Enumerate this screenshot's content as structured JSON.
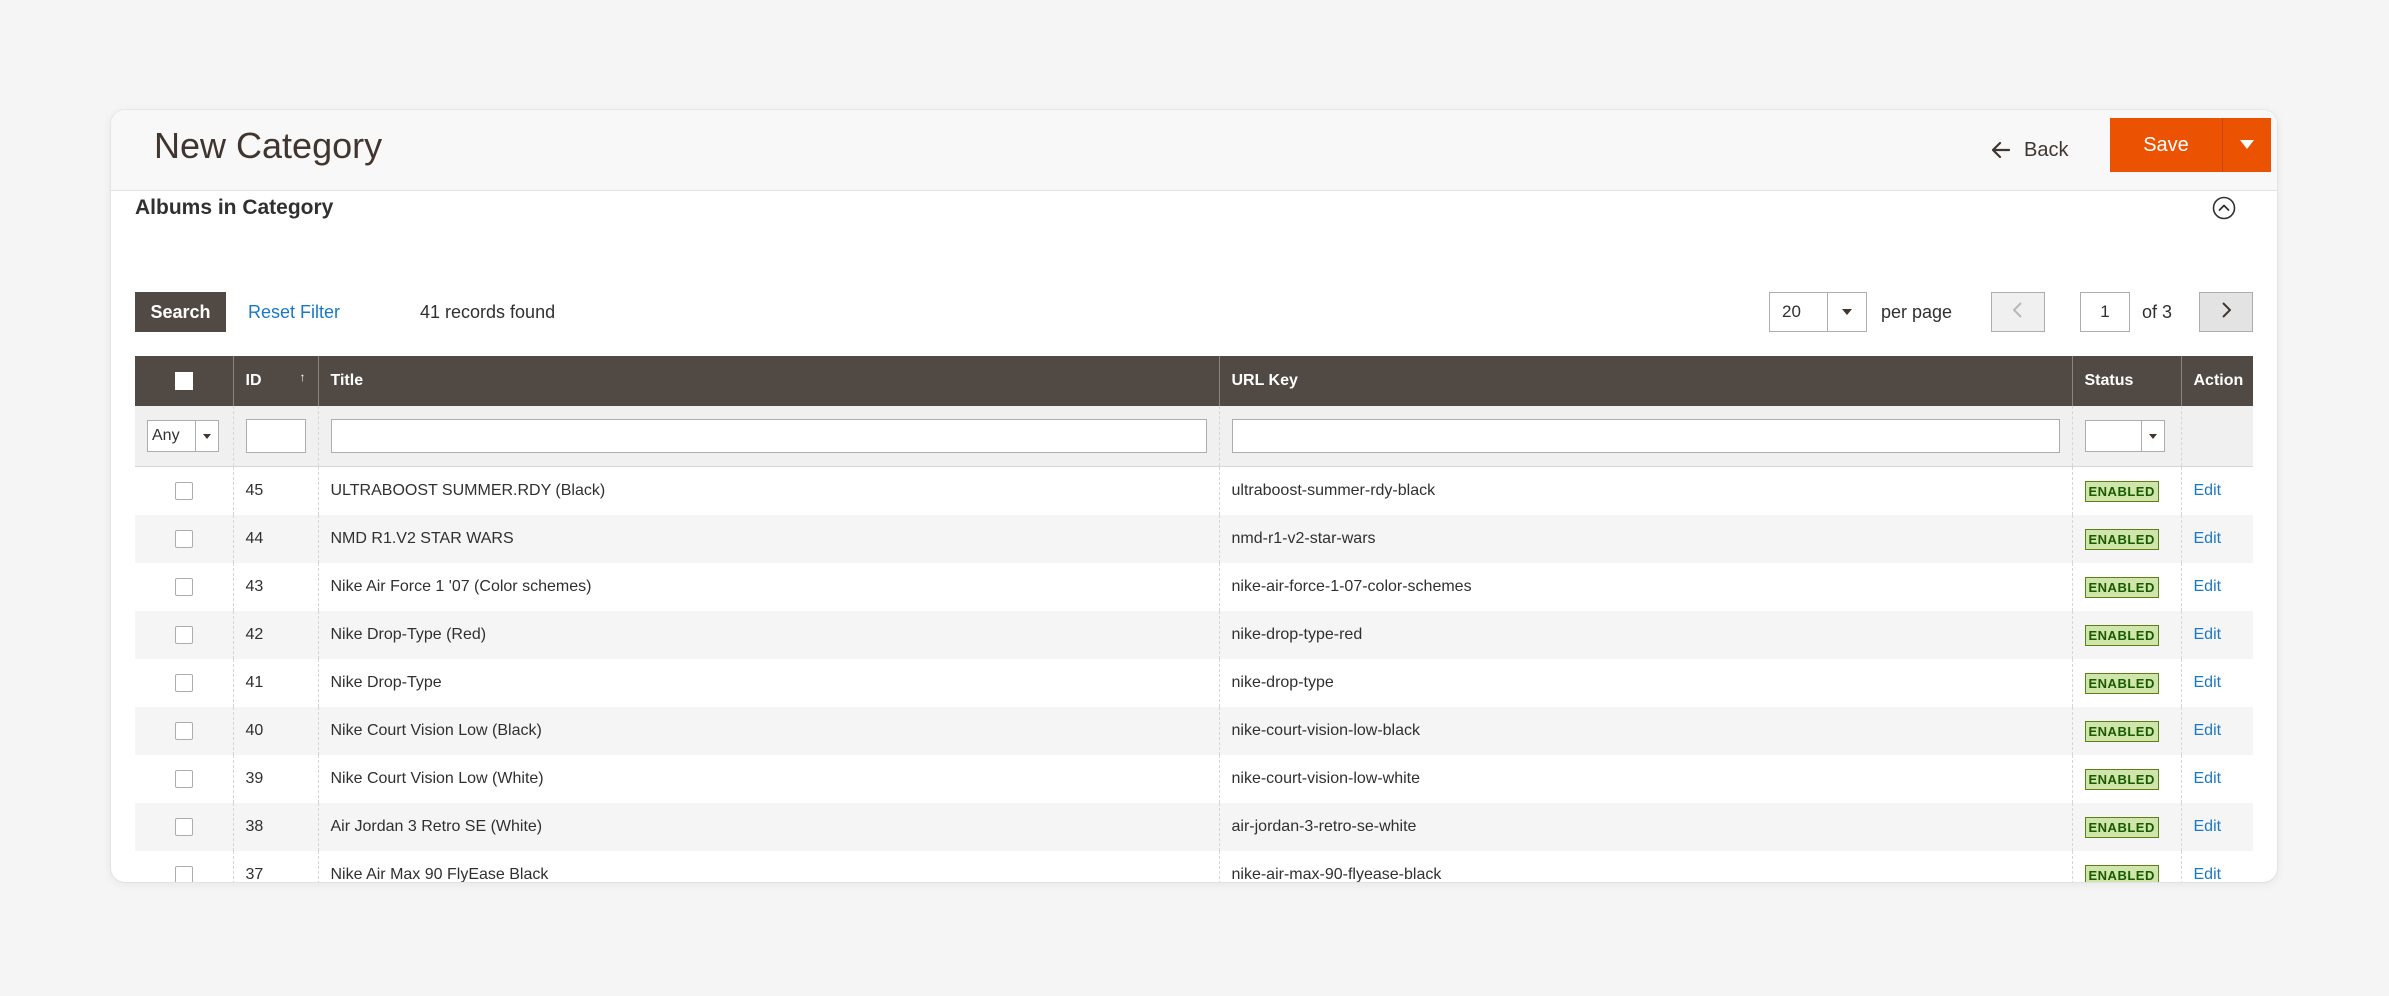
{
  "header": {
    "title": "New Category",
    "back_label": "Back",
    "save_label": "Save"
  },
  "section": {
    "title": "Albums in Category"
  },
  "toolbar": {
    "search_label": "Search",
    "reset_label": "Reset Filter",
    "records_found": "41 records found",
    "per_page_value": "20",
    "per_page_label": "per page",
    "current_page": "1",
    "page_of": "of 3"
  },
  "grid": {
    "columns": [
      "ID",
      "Title",
      "URL Key",
      "Status",
      "Action"
    ],
    "filters": {
      "select_any": "Any",
      "status_value": ""
    },
    "rows": [
      {
        "id": "45",
        "title": "ULTRABOOST SUMMER.RDY (Black)",
        "url_key": "ultraboost-summer-rdy-black",
        "status": "ENABLED",
        "action": "Edit"
      },
      {
        "id": "44",
        "title": "NMD R1.V2 STAR WARS",
        "url_key": "nmd-r1-v2-star-wars",
        "status": "ENABLED",
        "action": "Edit"
      },
      {
        "id": "43",
        "title": "Nike Air Force 1 '07 (Color schemes)",
        "url_key": "nike-air-force-1-07-color-schemes",
        "status": "ENABLED",
        "action": "Edit"
      },
      {
        "id": "42",
        "title": "Nike Drop-Type (Red)",
        "url_key": "nike-drop-type-red",
        "status": "ENABLED",
        "action": "Edit"
      },
      {
        "id": "41",
        "title": "Nike Drop-Type",
        "url_key": "nike-drop-type",
        "status": "ENABLED",
        "action": "Edit"
      },
      {
        "id": "40",
        "title": "Nike Court Vision Low (Black)",
        "url_key": "nike-court-vision-low-black",
        "status": "ENABLED",
        "action": "Edit"
      },
      {
        "id": "39",
        "title": "Nike Court Vision Low (White)",
        "url_key": "nike-court-vision-low-white",
        "status": "ENABLED",
        "action": "Edit"
      },
      {
        "id": "38",
        "title": "Air Jordan 3 Retro SE (White)",
        "url_key": "air-jordan-3-retro-se-white",
        "status": "ENABLED",
        "action": "Edit"
      },
      {
        "id": "37",
        "title": "Nike Air Max 90 FlyEase Black",
        "url_key": "nike-air-max-90-flyease-black",
        "status": "ENABLED",
        "action": "Edit"
      }
    ]
  },
  "colors": {
    "accent": "#eb5202",
    "grid_header": "#514943",
    "link": "#1979c3",
    "badge_bg": "#d0e5a9",
    "badge_text": "#185b00"
  }
}
